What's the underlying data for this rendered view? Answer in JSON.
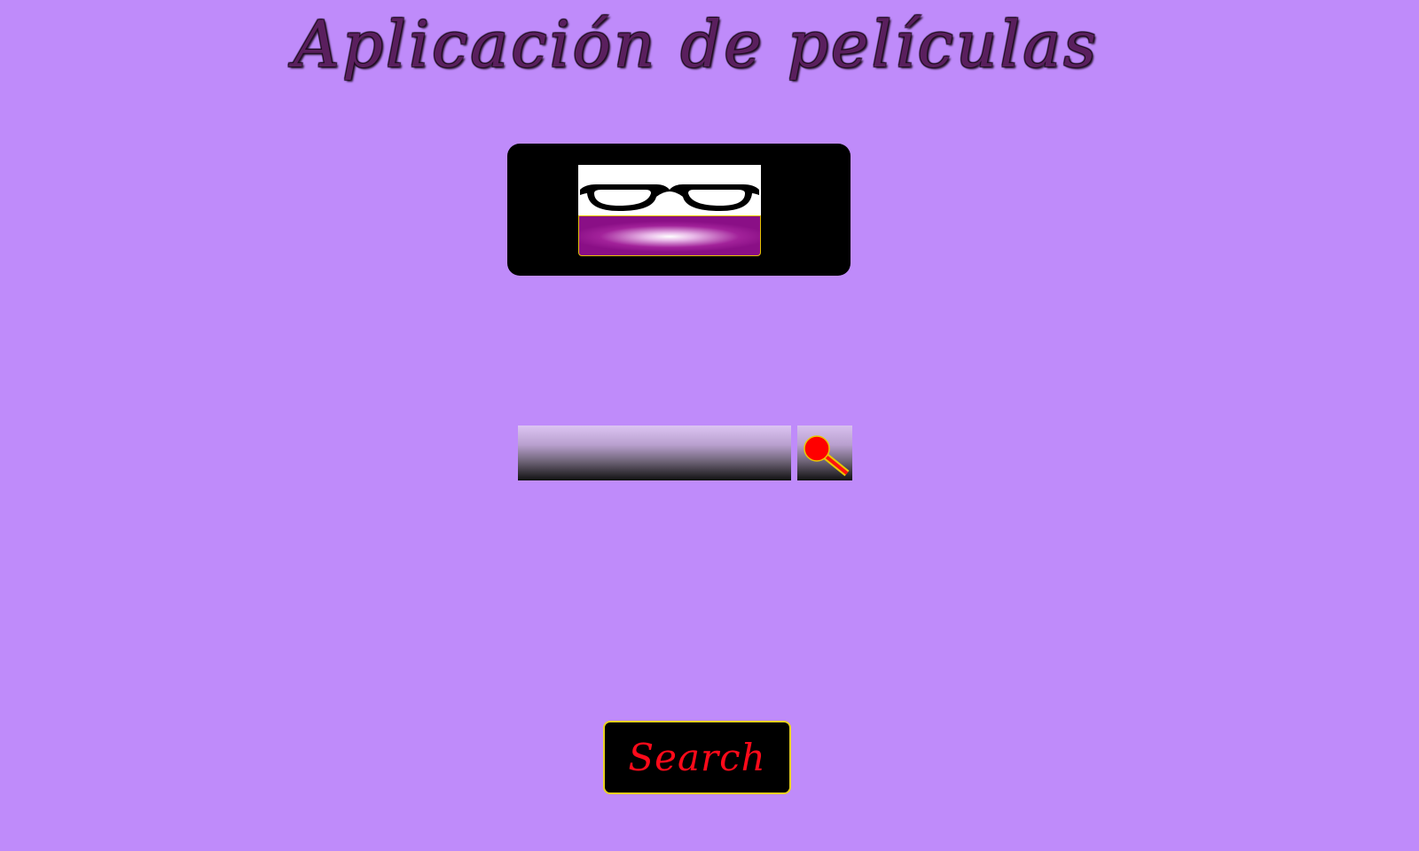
{
  "header": {
    "title": "Aplicación de películas"
  },
  "logo": {
    "icon": "glasses-icon",
    "accent_color": "#8a0f86"
  },
  "search": {
    "value": "",
    "placeholder": "",
    "icon": "magnifier-icon",
    "button_label": "Search"
  },
  "colors": {
    "background": "#bf8bfa",
    "button_text": "#ff0a1a",
    "button_border": "#e8d020"
  }
}
